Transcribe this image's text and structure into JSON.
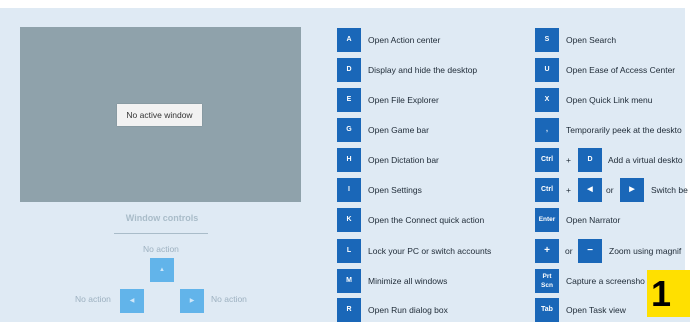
{
  "preview": {
    "label": "No active window"
  },
  "window_controls": {
    "heading": "Window controls",
    "up_label": "No action",
    "left_label": "No action",
    "right_label": "No action"
  },
  "left_column": [
    {
      "key": "A",
      "label": "Open Action center"
    },
    {
      "key": "D",
      "label": "Display and hide the desktop"
    },
    {
      "key": "E",
      "label": "Open File Explorer"
    },
    {
      "key": "G",
      "label": "Open Game bar"
    },
    {
      "key": "H",
      "label": "Open Dictation bar"
    },
    {
      "key": "I",
      "label": "Open Settings"
    },
    {
      "key": "K",
      "label": "Open the Connect quick action"
    },
    {
      "key": "L",
      "label": "Lock your PC or switch accounts"
    },
    {
      "key": "M",
      "label": "Minimize all windows"
    },
    {
      "key": "R",
      "label": "Open Run dialog box"
    }
  ],
  "right_column": {
    "s": {
      "key": "S",
      "label": "Open Search"
    },
    "u": {
      "key": "U",
      "label": "Open Ease of Access Center"
    },
    "x": {
      "key": "X",
      "label": "Open Quick Link menu"
    },
    "comma": {
      "key": ",",
      "label": "Temporarily peek at the deskto"
    },
    "ctrl_d": {
      "key1": "Ctrl",
      "plus": "+",
      "key2": "D",
      "label": "Add a virtual deskto"
    },
    "ctrl_arrows": {
      "key1": "Ctrl",
      "plus": "+",
      "or": "or",
      "label": "Switch be"
    },
    "enter": {
      "key": "Enter",
      "label": "Open Narrator"
    },
    "zoom": {
      "key1": "+",
      "or": "or",
      "key2": "−",
      "label": "Zoom using magnif"
    },
    "prtscn": {
      "key_line1": "Prt",
      "key_line2": "Scn",
      "label": "Capture a screensho"
    },
    "tab": {
      "key": "Tab",
      "label": "Open Task view"
    }
  },
  "badge": {
    "text": "1"
  }
}
